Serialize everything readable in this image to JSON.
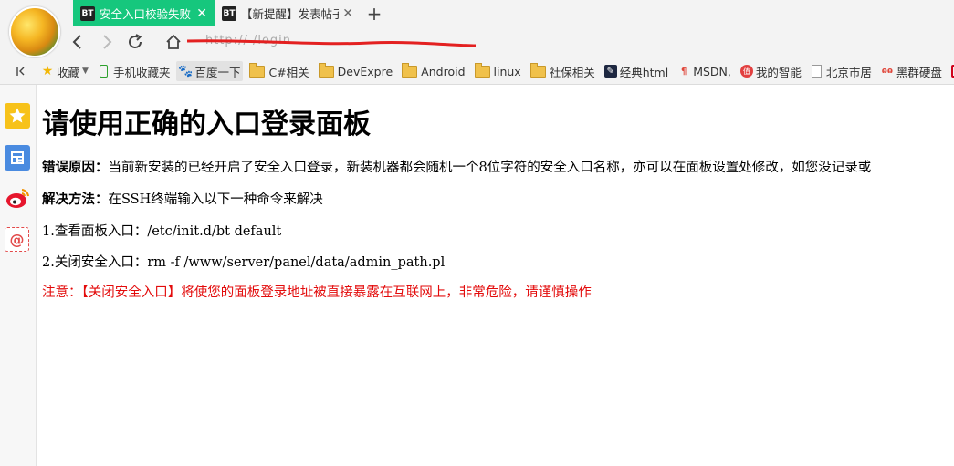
{
  "tabs": [
    {
      "icon": "BT",
      "title": "安全入口校验失败",
      "active": true
    },
    {
      "icon": "BT",
      "title": "【新提醒】发表帖子 - Linux面板",
      "active": false
    }
  ],
  "address": {
    "url_visible": "http://     /login"
  },
  "bookmarks": [
    {
      "label": "收藏",
      "icon": "star-icon"
    },
    {
      "label": "手机收藏夹",
      "icon": "phone-icon"
    },
    {
      "label": "百度一下",
      "icon": "baidu-paw-icon"
    },
    {
      "label": "C#相关",
      "icon": "folder-icon"
    },
    {
      "label": "DevExpre",
      "icon": "folder-icon"
    },
    {
      "label": "Android",
      "icon": "folder-icon"
    },
    {
      "label": "linux",
      "icon": "folder-icon"
    },
    {
      "label": "社保相关",
      "icon": "folder-icon"
    },
    {
      "label": "经典html",
      "icon": "feather-icon"
    },
    {
      "label": "MSDN,",
      "icon": "msdn-icon"
    },
    {
      "label": "我的智能",
      "icon": "smart-icon"
    },
    {
      "label": "北京市居",
      "icon": "page-icon"
    },
    {
      "label": "黑群硬盘",
      "icon": "nas-icon"
    }
  ],
  "page": {
    "title": "请使用正确的入口登录面板",
    "error_label": "错误原因：",
    "error_text": "当前新安装的已经开启了安全入口登录，新装机器都会随机一个8位字符的安全入口名称，亦可以在面板设置处修改，如您没记录或",
    "solution_label": "解决方法：",
    "solution_text": "在SSH终端输入以下一种命令来解决",
    "step1": "1.查看面板入口：/etc/init.d/bt default",
    "step2": "2.关闭安全入口：rm -f /www/server/panel/data/admin_path.pl",
    "warning": "注意：【关闭安全入口】将使您的面板登录地址被直接暴露在互联网上，非常危险，请谨慎操作"
  },
  "colors": {
    "active_tab": "#16c77d",
    "warning": "#e30b0b"
  }
}
